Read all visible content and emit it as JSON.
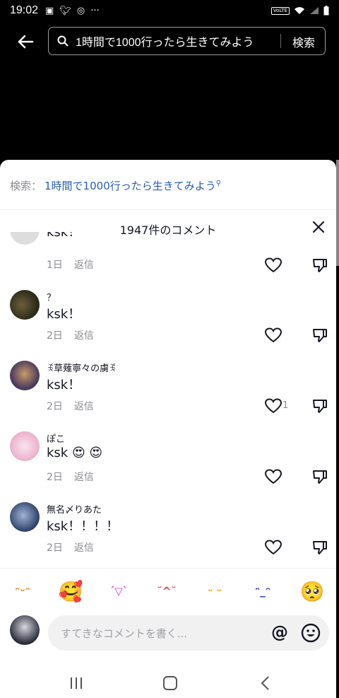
{
  "status": {
    "time": "19:02",
    "volte": "VoLTE"
  },
  "header": {
    "query": "1時間で1000行ったら生きてみよう",
    "search_button": "検索"
  },
  "sheet": {
    "search_label": "検索：",
    "search_link": "1時間で1000行ったら生きてみよう",
    "comment_count_title": "1947件のコメント"
  },
  "comments": [
    {
      "name": "",
      "text": "ksk！",
      "date": "1日",
      "reply": "返信",
      "likes": ""
    },
    {
      "name": "？",
      "text": "ksk！",
      "date": "2日",
      "reply": "返信",
      "likes": ""
    },
    {
      "name": "ꉂ草薙寧々の虜ꉂ",
      "text": "ksk！",
      "date": "2日",
      "reply": "返信",
      "likes": "1"
    },
    {
      "name": "ぽこ",
      "text": "ksk 😍 😍",
      "date": "2日",
      "reply": "返信",
      "likes": ""
    },
    {
      "name": "無名〆りあた",
      "text": "ksk！！！！",
      "date": "2日",
      "reply": "返信",
      "likes": ""
    }
  ],
  "emoji_bar": [
    {
      "glyph": "ᵔᵕᵔ",
      "color": "#e0801f"
    },
    {
      "glyph": "🥰",
      "color": "#e0801f"
    },
    {
      "glyph": "ˊ▽ˋ",
      "color": "#d63ad9"
    },
    {
      "glyph": "˘^˘",
      "color": "#e0403a"
    },
    {
      "glyph": "ᵕ ᵕ",
      "color": "#f0a020"
    },
    {
      "glyph": "ᵔ_ᵔ",
      "color": "#2636c9"
    },
    {
      "glyph": "🥺",
      "color": "#f0a020"
    }
  ],
  "input": {
    "placeholder": "すてきなコメントを書く...",
    "mention": "@"
  },
  "colors": {
    "link": "#2b5db0",
    "muted": "#8a8b91",
    "text": "#161823"
  }
}
